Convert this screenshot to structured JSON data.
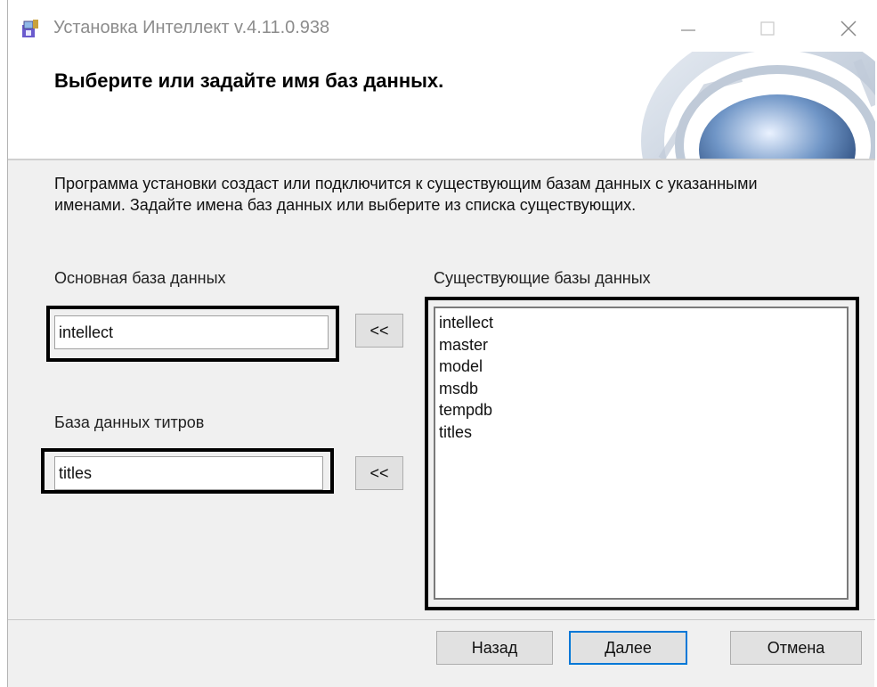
{
  "window": {
    "title": "Установка Интеллект v.4.11.0.938",
    "controls": [
      "—",
      "☐",
      "✕"
    ]
  },
  "banner": {
    "heading": "Выберите или задайте имя баз данных."
  },
  "description": "Программа установки создаст или подключится к существующим базам данных с указанными именами. Задайте имена баз данных или выберите из списка существующих.",
  "main_db": {
    "label": "Основная база данных",
    "value": "intellect",
    "pick_button": "<<"
  },
  "titles_db": {
    "label": "База данных титров",
    "value": "titles",
    "pick_button": "<<"
  },
  "existing": {
    "label": "Существующие базы данных",
    "items": [
      "intellect",
      "master",
      "model",
      "msdb",
      "tempdb",
      "titles"
    ]
  },
  "footer": {
    "back": "Назад",
    "next": "Далее",
    "cancel": "Отмена"
  },
  "colors": {
    "focus_border": "#0078d7",
    "annotation_border": "#000000",
    "banner_art": "#3a6fa6"
  }
}
